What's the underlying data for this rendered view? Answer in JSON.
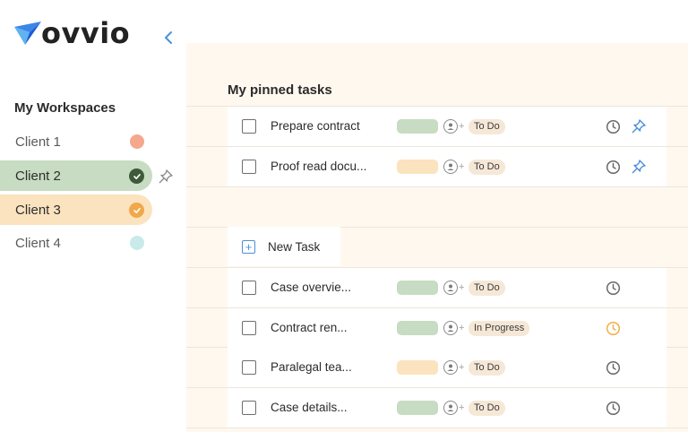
{
  "brand": {
    "name": "ovvio"
  },
  "sidebar": {
    "heading": "My Workspaces",
    "clients": [
      {
        "label": "Client 1",
        "state": "dot",
        "color": "#f5a88b"
      },
      {
        "label": "Client 2",
        "state": "checked",
        "color": "#3d5a3b",
        "bg": "#c7dcc2",
        "pinned": true
      },
      {
        "label": "Client 3",
        "state": "checked",
        "color": "#f0a84a",
        "bg": "#fbe3bf"
      },
      {
        "label": "Client 4",
        "state": "dot",
        "color": "#c8ebea"
      }
    ]
  },
  "main": {
    "pinned_title": "My pinned tasks",
    "pinned_tasks": [
      {
        "name": "Prepare contract",
        "tag_color": "green",
        "status": "To Do",
        "clock_color": "#6a6a6a",
        "pinned": true
      },
      {
        "name": "Proof read docu...",
        "tag_color": "peach",
        "status": "To Do",
        "clock_color": "#6a6a6a",
        "pinned": true
      }
    ],
    "new_task_label": "New Task",
    "tasks": [
      {
        "name": "Case overvie...",
        "tag_color": "green",
        "status": "To Do",
        "clock_color": "#6a6a6a"
      },
      {
        "name": "Contract ren...",
        "tag_color": "green",
        "status": "In Progress",
        "clock_color": "#f0b04a"
      },
      {
        "name": "Paralegal tea...",
        "tag_color": "peach",
        "status": "To Do",
        "clock_color": "#6a6a6a"
      },
      {
        "name": "Case details...",
        "tag_color": "green",
        "status": "To Do",
        "clock_color": "#6a6a6a"
      }
    ]
  },
  "colors": {
    "accent_blue": "#4a90d9",
    "logo_blue_dark": "#1f5bd6",
    "logo_blue_light": "#5fb3f0",
    "tag_green": "#c7dcc2",
    "tag_peach": "#fbe3bf",
    "main_bg": "#fff8ef"
  }
}
